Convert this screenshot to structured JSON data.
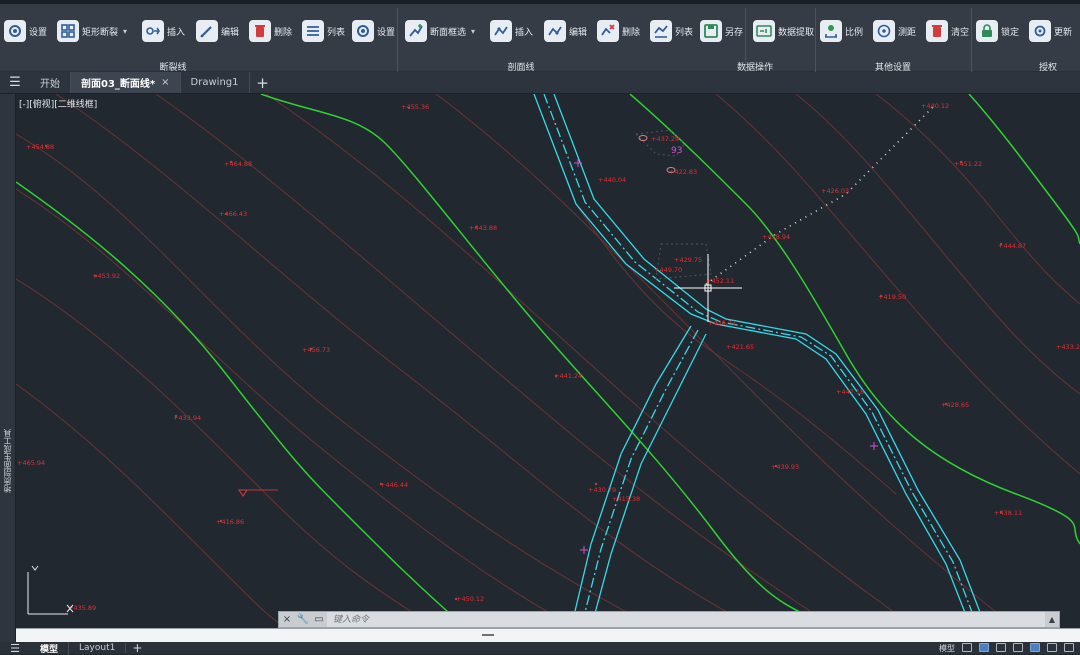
{
  "ribbon": {
    "buttons": [
      {
        "label": "设置"
      },
      {
        "label": "矩形断裂"
      },
      {
        "label": "插入"
      },
      {
        "label": "编辑"
      },
      {
        "label": "删除"
      },
      {
        "label": "列表"
      },
      {
        "label": "设置"
      },
      {
        "label": "断面框选"
      },
      {
        "label": "插入"
      },
      {
        "label": "编辑"
      },
      {
        "label": "删除"
      },
      {
        "label": "列表"
      },
      {
        "label": "另存"
      },
      {
        "label": "数据提取"
      },
      {
        "label": "比例"
      },
      {
        "label": "测距"
      },
      {
        "label": "清空"
      },
      {
        "label": "锁定"
      },
      {
        "label": "更新"
      }
    ],
    "groups": [
      "断裂线",
      "剖面线",
      "数据操作",
      "其他设置",
      "授权"
    ],
    "dropdown_glyph": "▾"
  },
  "tabs": [
    {
      "label": "开始"
    },
    {
      "label": "剖面03_断面线*",
      "close": "×"
    },
    {
      "label": "Drawing1"
    }
  ],
  "new_tab_glyph": "+",
  "left_palette": {
    "label": "地质剖面生成工具"
  },
  "viewport": {
    "label": "[-][俯视][二维线框]"
  },
  "elevations": [
    {
      "text": "+455.36"
    },
    {
      "text": "+454.88"
    },
    {
      "text": "+464.88"
    },
    {
      "text": "+466.43"
    },
    {
      "text": "+443.88"
    },
    {
      "text": "+453.92"
    },
    {
      "text": "+456.73"
    },
    {
      "text": "+441.24"
    },
    {
      "text": "+433.94"
    },
    {
      "text": "+465.94"
    },
    {
      "text": "+446.44"
    },
    {
      "text": "+416.86"
    },
    {
      "text": "+450.12"
    },
    {
      "text": "+435.89"
    },
    {
      "text": "+440.04"
    },
    {
      "text": "+437.29"
    },
    {
      "text": "+422.83"
    },
    {
      "text": "+429.75"
    },
    {
      "text": "+449.70"
    },
    {
      "text": "+452.11"
    },
    {
      "text": "+436.71"
    },
    {
      "text": "+421.65"
    },
    {
      "text": "+418.94"
    },
    {
      "text": "+426.03"
    },
    {
      "text": "+440.12"
    },
    {
      "text": "+451.22"
    },
    {
      "text": "+444.87"
    },
    {
      "text": "+419.50"
    },
    {
      "text": "+433.20"
    },
    {
      "text": "+447.18"
    },
    {
      "text": "+428.65"
    },
    {
      "text": "+439.93"
    },
    {
      "text": "+438.11"
    },
    {
      "text": "+430.79"
    },
    {
      "text": "+415.38"
    }
  ],
  "marker_label": "93",
  "command_line": {
    "placeholder": "键入命令"
  },
  "layout_tabs": [
    {
      "label": "模型"
    },
    {
      "label": "Layout1"
    }
  ],
  "status_right": {
    "model_label": "模型"
  }
}
